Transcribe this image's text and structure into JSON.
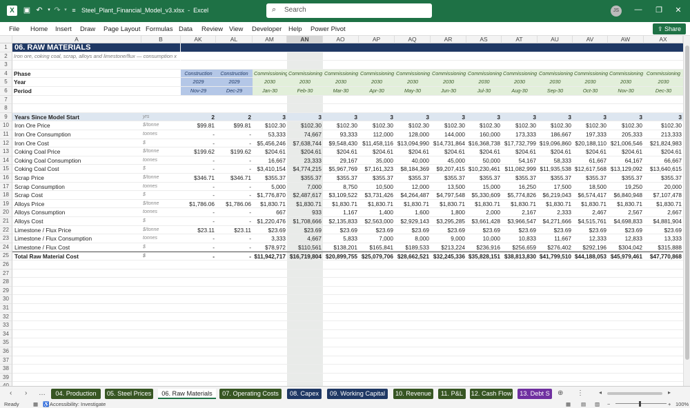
{
  "titlebar": {
    "file_name": "Steel_Plant_Financial_Model_v3.xlsx",
    "app": "Excel",
    "search_placeholder": "Search",
    "avatar": "JS"
  },
  "ribbon": {
    "tabs": [
      "File",
      "Home",
      "Insert",
      "Draw",
      "Page Layout",
      "Formulas",
      "Data",
      "Review",
      "View",
      "Developer",
      "Help",
      "Power Pivot"
    ],
    "share": "Share"
  },
  "columns": [
    "A",
    "B",
    "AK",
    "AL",
    "AM",
    "AN",
    "AO",
    "AP",
    "AQ",
    "AR",
    "AS",
    "AT",
    "AU",
    "AV",
    "AW",
    "AX"
  ],
  "sheet": {
    "title": "06. RAW MATERIALS",
    "subtitle": "Iron ore, coking coal, scrap, alloys and limestone/flux — consumption x",
    "labels": {
      "phase": "Phase",
      "year": "Year",
      "period": "Period"
    },
    "phase": [
      "Construction",
      "Construction",
      "Commissioning",
      "Commissioning",
      "Commissioning",
      "Commissioning",
      "Commissioning",
      "Commissioning",
      "Commissioning",
      "Commissioning",
      "Commissioning",
      "Commissioning",
      "Commissioning",
      "Commissioning"
    ],
    "year": [
      "2029",
      "2029",
      "2030",
      "2030",
      "2030",
      "2030",
      "2030",
      "2030",
      "2030",
      "2030",
      "2030",
      "2030",
      "2030",
      "2030"
    ],
    "period": [
      "Nov-29",
      "Dec-29",
      "Jan-30",
      "Feb-30",
      "Mar-30",
      "Apr-30",
      "May-30",
      "Jun-30",
      "Jul-30",
      "Aug-30",
      "Sep-30",
      "Oct-30",
      "Nov-30",
      "Dec-30"
    ],
    "rows": [
      {
        "label": "Years Since Model Start",
        "unit": "yrs",
        "bold": true,
        "band": true,
        "values": [
          "2",
          "2",
          "3",
          "3",
          "3",
          "3",
          "3",
          "3",
          "3",
          "3",
          "3",
          "3",
          "3",
          "3"
        ]
      },
      {
        "label": "Iron Ore Price",
        "unit": "$/tonne",
        "values": [
          "$99.81",
          "$99.81",
          "$102.30",
          "$102.30",
          "$102.30",
          "$102.30",
          "$102.30",
          "$102.30",
          "$102.30",
          "$102.30",
          "$102.30",
          "$102.30",
          "$102.30",
          "$102.30"
        ]
      },
      {
        "label": "Iron Ore Consumption",
        "unit": "tonnes",
        "values": [
          "-",
          "-",
          "53,333",
          "74,667",
          "93,333",
          "112,000",
          "128,000",
          "144,000",
          "160,000",
          "173,333",
          "186,667",
          "197,333",
          "205,333",
          "213,333"
        ]
      },
      {
        "label": "Iron Ore Cost",
        "unit": "$",
        "values": [
          "-",
          "-",
          "$5,456,246",
          "$7,638,744",
          "$9,548,430",
          "$11,458,116",
          "$13,094,990",
          "$14,731,864",
          "$16,368,738",
          "$17,732,799",
          "$19,096,860",
          "$20,188,110",
          "$21,006,546",
          "$21,824,983"
        ]
      },
      {
        "label": "Coking Coal Price",
        "unit": "$/tonne",
        "values": [
          "$199.62",
          "$199.62",
          "$204.61",
          "$204.61",
          "$204.61",
          "$204.61",
          "$204.61",
          "$204.61",
          "$204.61",
          "$204.61",
          "$204.61",
          "$204.61",
          "$204.61",
          "$204.61"
        ]
      },
      {
        "label": "Coking Coal Consumption",
        "unit": "tonnes",
        "values": [
          "-",
          "-",
          "16,667",
          "23,333",
          "29,167",
          "35,000",
          "40,000",
          "45,000",
          "50,000",
          "54,167",
          "58,333",
          "61,667",
          "64,167",
          "66,667"
        ]
      },
      {
        "label": "Coking Coal Cost",
        "unit": "$",
        "values": [
          "-",
          "-",
          "$3,410,154",
          "$4,774,215",
          "$5,967,769",
          "$7,161,323",
          "$8,184,369",
          "$9,207,415",
          "$10,230,461",
          "$11,082,999",
          "$11,935,538",
          "$12,617,568",
          "$13,129,092",
          "$13,640,615"
        ]
      },
      {
        "label": "Scrap Price",
        "unit": "$/tonne",
        "values": [
          "$346.71",
          "$346.71",
          "$355.37",
          "$355.37",
          "$355.37",
          "$355.37",
          "$355.37",
          "$355.37",
          "$355.37",
          "$355.37",
          "$355.37",
          "$355.37",
          "$355.37",
          "$355.37"
        ]
      },
      {
        "label": "Scrap Consumption",
        "unit": "tonnes",
        "values": [
          "-",
          "-",
          "5,000",
          "7,000",
          "8,750",
          "10,500",
          "12,000",
          "13,500",
          "15,000",
          "16,250",
          "17,500",
          "18,500",
          "19,250",
          "20,000"
        ]
      },
      {
        "label": "Scrap Cost",
        "unit": "$",
        "values": [
          "-",
          "-",
          "$1,776,870",
          "$2,487,617",
          "$3,109,522",
          "$3,731,426",
          "$4,264,487",
          "$4,797,548",
          "$5,330,609",
          "$5,774,826",
          "$6,219,043",
          "$6,574,417",
          "$6,840,948",
          "$7,107,478"
        ]
      },
      {
        "label": "Alloys Price",
        "unit": "$/tonne",
        "values": [
          "$1,786.06",
          "$1,786.06",
          "$1,830.71",
          "$1,830.71",
          "$1,830.71",
          "$1,830.71",
          "$1,830.71",
          "$1,830.71",
          "$1,830.71",
          "$1,830.71",
          "$1,830.71",
          "$1,830.71",
          "$1,830.71",
          "$1,830.71"
        ]
      },
      {
        "label": "Alloys Consumption",
        "unit": "tonnes",
        "values": [
          "-",
          "-",
          "667",
          "933",
          "1,167",
          "1,400",
          "1,600",
          "1,800",
          "2,000",
          "2,167",
          "2,333",
          "2,467",
          "2,567",
          "2,667"
        ]
      },
      {
        "label": "Alloys Cost",
        "unit": "$",
        "values": [
          "-",
          "-",
          "$1,220,476",
          "$1,708,666",
          "$2,135,833",
          "$2,563,000",
          "$2,929,143",
          "$3,295,285",
          "$3,661,428",
          "$3,966,547",
          "$4,271,666",
          "$4,515,761",
          "$4,698,833",
          "$4,881,904"
        ]
      },
      {
        "label": "Limestone / Flux Price",
        "unit": "$/tonne",
        "values": [
          "$23.11",
          "$23.11",
          "$23.69",
          "$23.69",
          "$23.69",
          "$23.69",
          "$23.69",
          "$23.69",
          "$23.69",
          "$23.69",
          "$23.69",
          "$23.69",
          "$23.69",
          "$23.69"
        ]
      },
      {
        "label": "Limestone / Flux Consumption",
        "unit": "tonnes",
        "values": [
          "-",
          "-",
          "3,333",
          "4,667",
          "5,833",
          "7,000",
          "8,000",
          "9,000",
          "10,000",
          "10,833",
          "11,667",
          "12,333",
          "12,833",
          "13,333"
        ]
      },
      {
        "label": "Limestone / Flux Cost",
        "unit": "$",
        "values": [
          "-",
          "-",
          "$78,972",
          "$110,561",
          "$138,201",
          "$165,841",
          "$189,533",
          "$213,224",
          "$236,916",
          "$256,659",
          "$276,402",
          "$292,196",
          "$304,042",
          "$315,888"
        ]
      },
      {
        "label": "Total Raw Material Cost",
        "unit": "$",
        "total": true,
        "values": [
          "-",
          "-",
          "$11,942,717",
          "$16,719,804",
          "$20,899,755",
          "$25,079,706",
          "$28,662,521",
          "$32,245,336",
          "$35,828,151",
          "$38,813,830",
          "$41,799,510",
          "$44,188,053",
          "$45,979,461",
          "$47,770,868"
        ]
      }
    ]
  },
  "sheet_tabs": [
    {
      "label": "04. Production",
      "color": "#375623"
    },
    {
      "label": "05. Steel Prices",
      "color": "#375623"
    },
    {
      "label": "06. Raw Materials",
      "color": "#375623",
      "active": true
    },
    {
      "label": "07. Operating Costs",
      "color": "#375623"
    },
    {
      "label": "08. Capex",
      "color": "#1f3864"
    },
    {
      "label": "09. Working Capital",
      "color": "#1f3864"
    },
    {
      "label": "10. Revenue",
      "color": "#375623"
    },
    {
      "label": "11. P&L",
      "color": "#375623"
    },
    {
      "label": "12. Cash Flow",
      "color": "#375623"
    },
    {
      "label": "13. Debt S",
      "color": "#7030a0"
    }
  ],
  "status": {
    "ready": "Ready",
    "accessibility": "Accessibility: Investigate",
    "zoom": "100%"
  }
}
